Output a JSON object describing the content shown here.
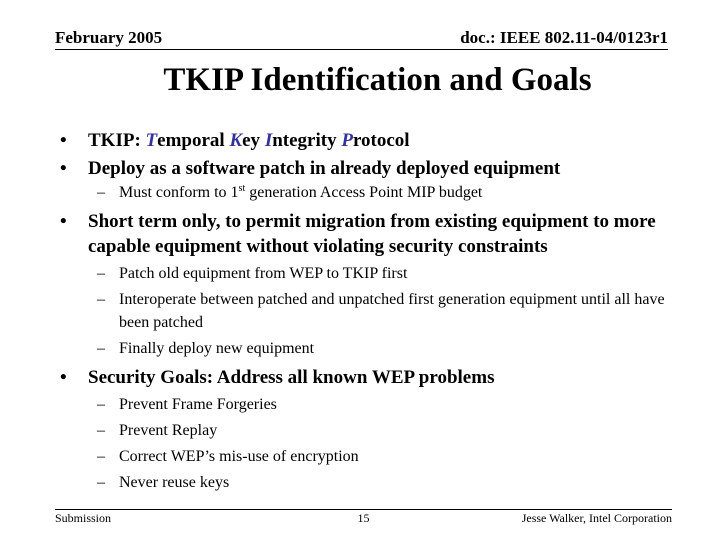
{
  "header": {
    "date": "February 2005",
    "doc_id": "doc.: IEEE 802.11-04/0123r1"
  },
  "title": "TKIP Identification and Goals",
  "accent_color": "#333399",
  "bullet_glyph": "•",
  "dash_glyph": "–",
  "bullets": [
    {
      "prefix": "TKIP: ",
      "acronym_parts": [
        {
          "initial": "T",
          "rest": "emporal "
        },
        {
          "initial": "K",
          "rest": "ey "
        },
        {
          "initial": "I",
          "rest": "ntegrity "
        },
        {
          "initial": "P",
          "rest": "rotocol"
        }
      ]
    },
    {
      "text": "Deploy as a software patch in already deployed equipment",
      "subs": [
        {
          "before": "Must conform to 1",
          "sup": "st",
          "after": " generation Access Point MIP budget"
        }
      ]
    },
    {
      "text": "Short term only, to permit migration from existing equipment to more capable equipment without violating security constraints",
      "subs": [
        {
          "text": "Patch old equipment from WEP to TKIP first"
        },
        {
          "text": "Interoperate between patched and unpatched first generation equipment until all have been patched"
        },
        {
          "text": "Finally deploy new equipment"
        }
      ]
    },
    {
      "text": "Security Goals: Address all known WEP problems",
      "subs": [
        {
          "text": "Prevent Frame Forgeries"
        },
        {
          "text": "Prevent Replay"
        },
        {
          "text": "Correct WEP’s mis-use of encryption"
        },
        {
          "text": "Never reuse keys"
        }
      ]
    }
  ],
  "footer": {
    "left": "Submission",
    "page_number": "15",
    "right": "Jesse Walker, Intel Corporation"
  }
}
